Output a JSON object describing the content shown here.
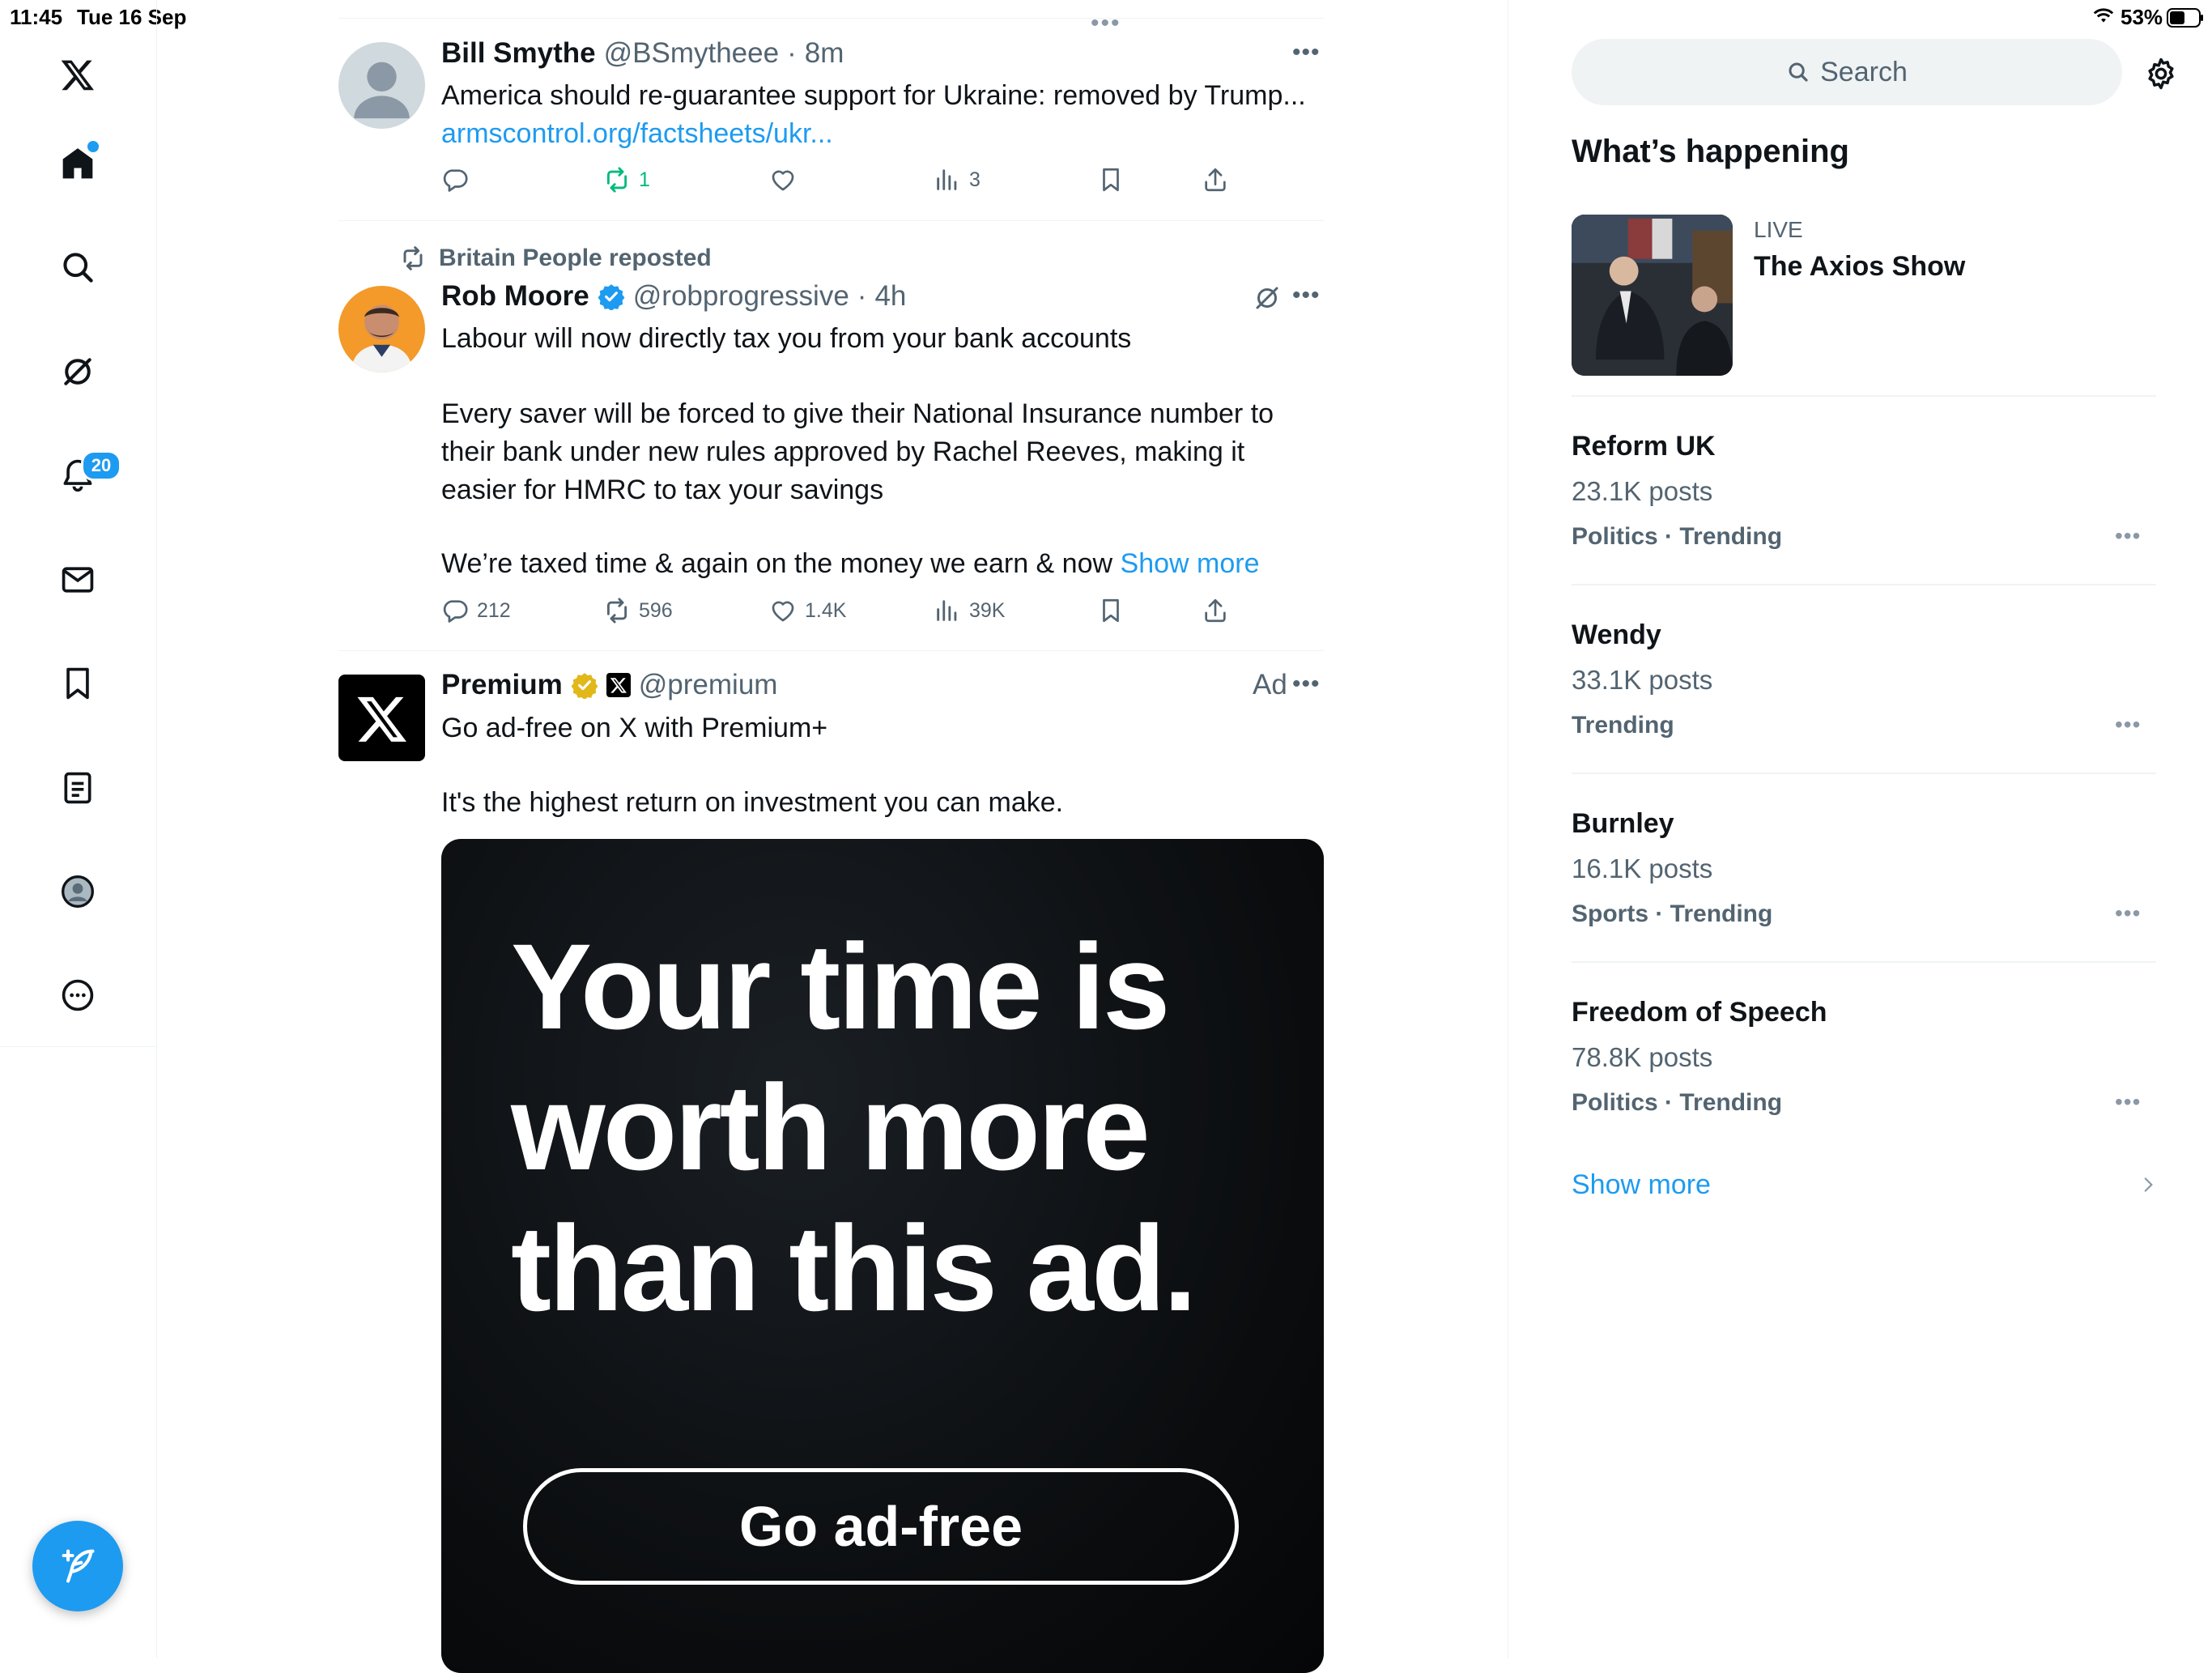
{
  "status_bar": {
    "time": "11:45",
    "date": "Tue 16 Sep",
    "battery": "53%"
  },
  "nav": {
    "notifications_badge": "20"
  },
  "tweets": [
    {
      "name": "Bill Smythe",
      "handle": "@BSmytheee",
      "time": "8m",
      "text": "America should re-guarantee support for Ukraine: removed by Trump...",
      "link": "armscontrol.org/factsheets/ukr...",
      "reposts": "1",
      "views": "3"
    },
    {
      "reposted_by": "Britain People reposted",
      "name": "Rob Moore",
      "handle": "@robprogressive",
      "time": "4h",
      "p1": "Labour will now directly tax you from your bank accounts",
      "p2": "Every saver will be forced to give their National Insurance number to their bank under new rules approved by Rachel Reeves, making it easier for HMRC to tax your savings",
      "p3": "We’re taxed time & again on the money we earn & now",
      "show_more": "Show more",
      "replies": "212",
      "reposts": "596",
      "likes": "1.4K",
      "views": "39K"
    },
    {
      "name": "Premium",
      "handle": "@premium",
      "ad_label": "Ad",
      "line1": "Go ad-free on X with Premium+",
      "line2": "It's the highest return on investment you can make.",
      "ad_headline_1": "Your time is",
      "ad_headline_2": "worth more",
      "ad_headline_3": "than this ad.",
      "ad_button": "Go ad-free"
    }
  ],
  "sidebar": {
    "search_placeholder": "Search",
    "section_title": "What’s happening",
    "live_label": "LIVE",
    "live_title": "The Axios Show",
    "trends": [
      {
        "title": "Reform UK",
        "count": "23.1K posts",
        "category": "Politics · Trending"
      },
      {
        "title": "Wendy",
        "count": "33.1K posts",
        "category": "Trending"
      },
      {
        "title": "Burnley",
        "count": "16.1K posts",
        "category": "Sports · Trending"
      },
      {
        "title": "Freedom of Speech",
        "count": "78.8K posts",
        "category": "Politics · Trending"
      }
    ],
    "show_more": "Show more"
  }
}
